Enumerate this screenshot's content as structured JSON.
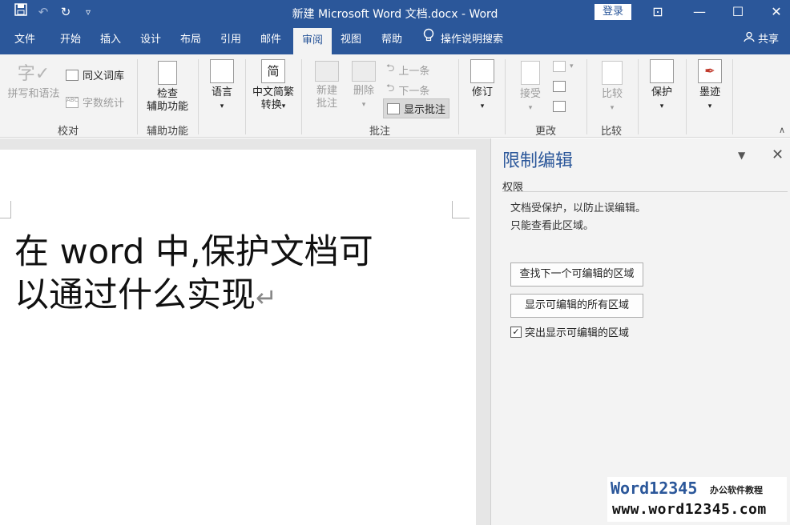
{
  "titlebar": {
    "doc_title": "新建 Microsoft Word 文档.docx  -  Word",
    "login": "登录",
    "qat": {
      "save": "save-icon",
      "undo": "↶",
      "redo": "↻",
      "more": "▿"
    },
    "win_ribbon_opts": "⊡",
    "win_min": "—",
    "win_max": "☐",
    "win_close": "✕"
  },
  "tabs": {
    "file": "文件",
    "home": "开始",
    "insert": "插入",
    "design": "设计",
    "layout": "布局",
    "references": "引用",
    "mailings": "邮件",
    "review": "审阅",
    "view": "视图",
    "help": "帮助",
    "tell_me": "操作说明搜索",
    "share": "共享"
  },
  "ribbon": {
    "spelling": "拼写和语法",
    "thesaurus": "同义词库",
    "wordcount": "字数统计",
    "proofing_label": "校对",
    "check_access_1": "检查",
    "check_access_2": "辅助功能",
    "accessibility_label": "辅助功能",
    "language": "语言",
    "chinese_conv_1": "中文简繁",
    "chinese_conv_2": "转换",
    "new_comment_1": "新建",
    "new_comment_2": "批注",
    "delete": "删除",
    "prev": "上一条",
    "next": "下一条",
    "show_comments": "显示批注",
    "comments_label": "批注",
    "track": "修订",
    "accept": "接受",
    "changes_label": "更改",
    "compare": "比较",
    "compare_label": "比较",
    "protect": "保护",
    "ink": "墨迹"
  },
  "document": {
    "line1": "在 word 中,保护文档可",
    "line2": "以通过什么实现",
    "para_mark": "↵"
  },
  "pane": {
    "title": "限制编辑",
    "section": "权限",
    "msg1": "文档受保护，以防止误编辑。",
    "msg2": "只能查看此区域。",
    "find_next": "查找下一个可编辑的区域",
    "show_all": "显示可编辑的所有区域",
    "highlight": "突出显示可编辑的区域",
    "highlight_checked": true
  },
  "watermark": {
    "brand": "Word12345",
    "sub": "办公软件教程",
    "url": "www.word12345.com"
  }
}
